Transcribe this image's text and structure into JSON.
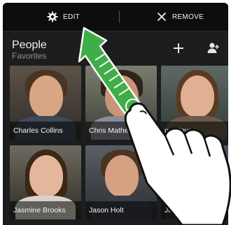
{
  "action_bar": {
    "edit_label": "EDIT",
    "remove_label": "REMOVE",
    "edit_icon": "gear-icon",
    "remove_icon": "close-icon"
  },
  "widget": {
    "title": "People",
    "subtitle": "Favorites",
    "add_icon": "plus-icon",
    "contacts_icon": "contacts-icon"
  },
  "contacts": [
    {
      "name": "Charles Collins"
    },
    {
      "name": "Chris Mathew"
    },
    {
      "name": "na Mayer"
    },
    {
      "name": "Jasmine Brooks"
    },
    {
      "name": "Jason Holt"
    },
    {
      "name": "Jerome Will"
    }
  ],
  "colors": {
    "gesture_green": "#3fae49",
    "background": "#1c1d1f"
  }
}
